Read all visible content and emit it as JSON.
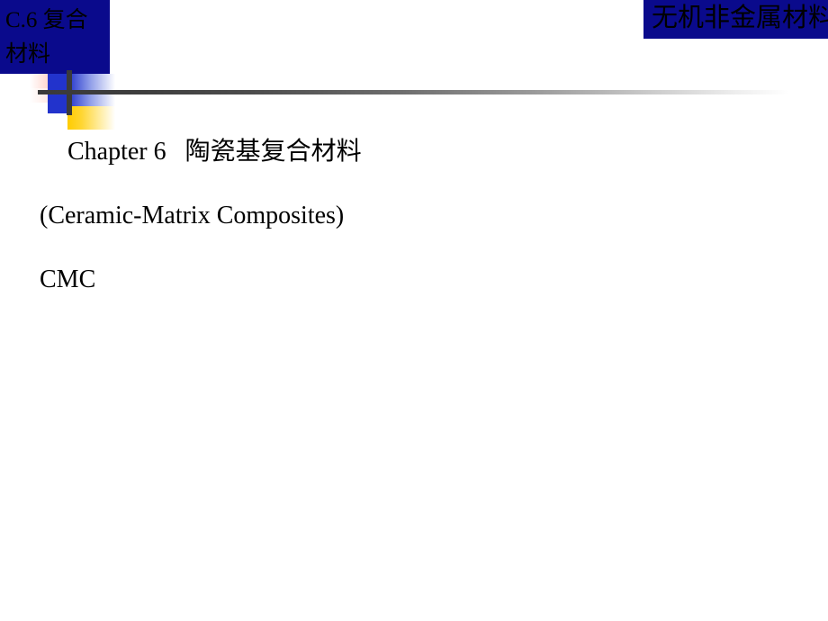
{
  "slide": {
    "title_box": {
      "text": "C.6 复合材料",
      "background_color": "#0a0a8c",
      "text_color": "#000000"
    },
    "banner_box": {
      "text": "无机非金属材料",
      "background_color": "#0a0a8c",
      "text_color": "#000000"
    },
    "ornament": {
      "red_block_color": "#ff4d3d",
      "blue_block_color": "#2233cc",
      "yellow_block_color": "#ffcc00",
      "bar_color": "#3a3a3a"
    },
    "body": {
      "lines": [
        {
          "text": "Chapter 6   陶瓷基复合材料",
          "indent": true
        },
        {
          "text": "(Ceramic-Matrix Composites)",
          "indent": false
        },
        {
          "text": "CMC",
          "indent": false
        }
      ]
    },
    "background_color": "#ffffff"
  }
}
